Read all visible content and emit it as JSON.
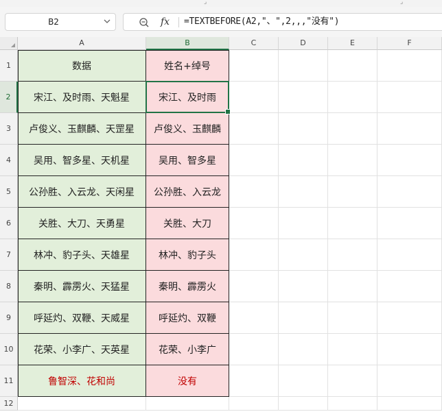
{
  "name_box": "B2",
  "formula_icon": "fx",
  "formula": "=TEXTBEFORE(A2,\"、\",2,,,\"没有\")",
  "columns": [
    "A",
    "B",
    "C",
    "D",
    "E",
    "F"
  ],
  "rows": [
    "1",
    "2",
    "3",
    "4",
    "5",
    "6",
    "7",
    "8",
    "9",
    "10",
    "11",
    "12"
  ],
  "header": {
    "a": "数据",
    "b": "姓名+绰号"
  },
  "records": [
    {
      "a": "宋江、及时雨、天魁星",
      "b": "宋江、及时雨"
    },
    {
      "a": "卢俊义、玉麒麟、天罡星",
      "b": "卢俊义、玉麒麟"
    },
    {
      "a": "吴用、智多星、天机星",
      "b": "吴用、智多星"
    },
    {
      "a": "公孙胜、入云龙、天闲星",
      "b": "公孙胜、入云龙"
    },
    {
      "a": "关胜、大刀、天勇星",
      "b": "关胜、大刀"
    },
    {
      "a": "林冲、豹子头、天雄星",
      "b": "林冲、豹子头"
    },
    {
      "a": "秦明、霹雳火、天猛星",
      "b": "秦明、霹雳火"
    },
    {
      "a": "呼延灼、双鞭、天威星",
      "b": "呼延灼、双鞭"
    },
    {
      "a": "花荣、小李广、天英星",
      "b": "花荣、小李广"
    },
    {
      "a": "鲁智深、花和尚",
      "b": "没有",
      "red": true
    }
  ],
  "colors": {
    "accent": "#217346",
    "col_a_fill": "#e2efda",
    "col_b_fill": "#fbdbdd",
    "red_text": "#c00000"
  },
  "icons": {
    "name_box_dropdown": "chevron-down-icon",
    "zoom": "zoom-icon",
    "fx": "fx-icon"
  }
}
